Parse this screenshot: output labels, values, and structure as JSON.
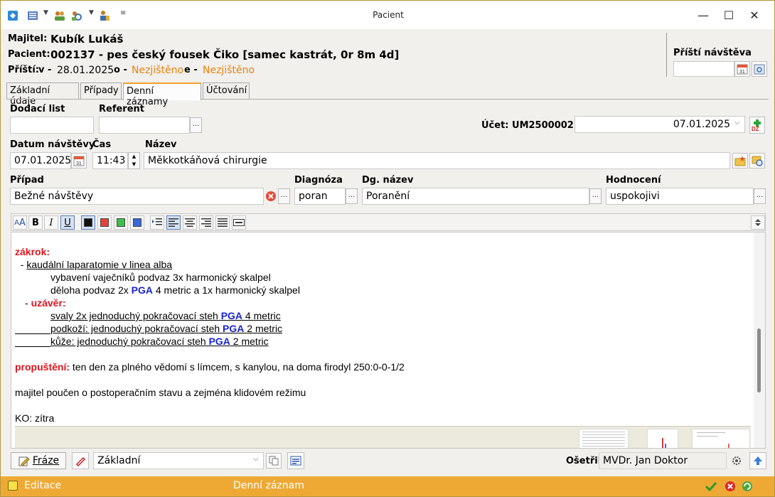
{
  "window": {
    "title": "Pacient"
  },
  "quick_access": {
    "icons": [
      "app-icon",
      "list-icon",
      "group-icon",
      "search-users-icon",
      "people-icon"
    ]
  },
  "header": {
    "owner_label": "Majitel:",
    "owner_value": "Kubík Lukáš",
    "patient_label": "Pacient:",
    "patient_value": "002137 - pes český fousek Čiko [samec kastrát, 0r  8m  4d]",
    "next_label": "Příští:",
    "next_v_label": "v -",
    "next_v_value": "28.01.2025",
    "next_o_label": "o -",
    "next_o_value": "Nezjištěno",
    "next_e_label": "e -",
    "next_e_value": "Nezjištěno",
    "next_visit_label": "Příští návštěva",
    "next_visit_value": ""
  },
  "tabs": [
    {
      "label": "Základní údaje",
      "active": false
    },
    {
      "label": "Případy",
      "active": false
    },
    {
      "label": "Denní záznamy",
      "active": true
    },
    {
      "label": "Účtování",
      "active": false
    }
  ],
  "form": {
    "delivery_label": "Dodací list",
    "delivery_value": "",
    "referent_label": "Referent",
    "referent_value": "",
    "account_label": "Účet: UM2500002",
    "account_date": "07.01.2025",
    "visit_date_label": "Datum návštěvy",
    "visit_date_value": "07.01.2025",
    "time_label": "Čas",
    "time_value": "11:43",
    "name_label": "Název",
    "name_value": "Měkkotkáňová chirurgie",
    "case_label": "Případ",
    "case_value": "Bežné návštěvy",
    "diagnosis_label": "Diagnóza",
    "diagnosis_value": "poran",
    "dg_name_label": "Dg. název",
    "dg_name_value": "Poranění",
    "rating_label": "Hodnocení",
    "rating_value": "uspokojivi",
    "ellipsis": "..."
  },
  "editor": {
    "lines": {
      "l1_label": "zákrok:",
      "l2_prefix": "  - ",
      "l2_text": "kaudální laparatomie v linea alba",
      "l3": "vybavení vaječníků podvaz 3x harmonický skalpel",
      "l4_a": "děloha podvaz 2x ",
      "l4_b": "PGA",
      "l4_c": " 4 metric a 1x harmonický skalpel",
      "l5_label": "uzávěr:",
      "l6_a": "svaly 2x jednoduchý pokračovací steh ",
      "l6_b": "PGA",
      "l6_c": " 4 metric",
      "l7_a": "podkoží: jednoduchý pokračovací steh ",
      "l7_b": "PGA",
      "l7_c": " 2 metric",
      "l8_a": "kůže: jednoduchý pokračovací steh ",
      "l8_b": "PGA",
      "l8_c": " 2 metric",
      "l9_label": "propuštění:",
      "l9_text": " ten den za plného vědomí s límcem, s kanylou, na doma firodyl 250:0-0-1/2",
      "l10": "majitel poučen o postoperačním stavu a zejména klidovém režimu",
      "l11": "KO: zítra"
    },
    "toolbar": {
      "font_size": "A",
      "bold": "B",
      "italic": "I",
      "underline": "U",
      "colors": [
        "#111111",
        "#e8403a",
        "#3cc24a",
        "#3a6bd3"
      ]
    }
  },
  "bottom": {
    "phrases_label": "Fráze",
    "style_value": "Základní",
    "treated_label": "Ošetřil",
    "treated_value": "MVDr. Jan Doktor"
  },
  "status": {
    "mode": "Editace",
    "record": "Denní záznam"
  },
  "colors": {
    "accent_orange": "#e8820c",
    "status_bar": "#eea935",
    "red_heading": "#e0141e",
    "blue_pga": "#1a25d0"
  }
}
